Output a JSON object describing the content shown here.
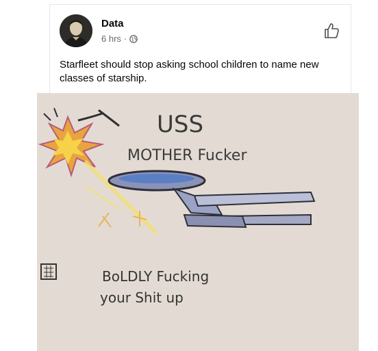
{
  "post": {
    "author": "Data",
    "time": "6 hrs",
    "separator": "·",
    "text": "Starfleet should stop asking school children to name new classes of starship."
  },
  "drawing": {
    "line1": "USS",
    "line2": "MOTHER Fucker",
    "line3": "BoLDLY Fucking",
    "line4": "your Shit up"
  },
  "icons": {
    "privacy": "globe-icon",
    "like": "thumbs-up-icon"
  },
  "colors": {
    "card_bg": "#ffffff",
    "text": "#050505",
    "meta": "#65676b",
    "paper": "#e7dfd7",
    "ink": "#3a3a3a",
    "ship_blue": "#5b7fc4",
    "explosion": "#f1a63a"
  }
}
